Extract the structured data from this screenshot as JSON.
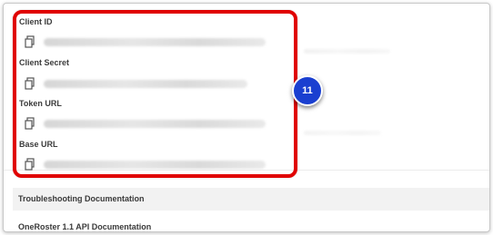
{
  "credentials": {
    "fields": [
      {
        "label": "Client ID"
      },
      {
        "label": "Client Secret"
      },
      {
        "label": "Token URL"
      },
      {
        "label": "Base URL"
      }
    ]
  },
  "annotation": {
    "step_number": "11"
  },
  "links": {
    "troubleshooting": "Troubleshooting Documentation",
    "api_docs": "OneRoster 1.1 API Documentation"
  },
  "colors": {
    "highlight": "#e00000",
    "badge": "#1a3fd0"
  }
}
